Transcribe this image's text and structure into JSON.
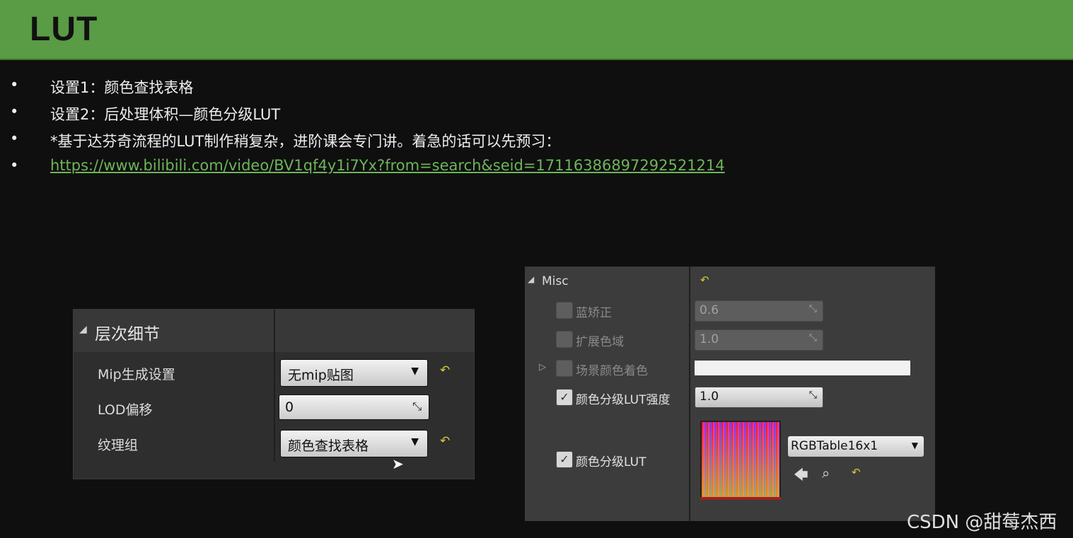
{
  "slide": {
    "title": "LUT",
    "bullets": [
      {
        "text": "设置1：颜色查找表格"
      },
      {
        "text": "设置2：后处理体积—颜色分级LUT"
      },
      {
        "text": "*基于达芬奇流程的LUT制作稍复杂，进阶课会专门讲。着急的话可以先预习："
      },
      {
        "text": "https://www.bilibili.com/video/BV1qf4y1i7Yx?from=search&seid=17116386897292521214",
        "is_link": true
      }
    ],
    "bullet_glyph": "•"
  },
  "lod_panel": {
    "header": "层次细节",
    "rows": [
      {
        "label": "Mip生成设置",
        "value": "无mip贴图",
        "control": "dropdown",
        "has_reset": true
      },
      {
        "label": "LOD偏移",
        "value": "0",
        "control": "number",
        "has_reset": false
      },
      {
        "label": "纹理组",
        "value": "颜色查找表格",
        "control": "dropdown",
        "has_reset": true
      }
    ]
  },
  "misc_panel": {
    "header": "Misc",
    "rows": [
      {
        "label": "蓝矫正",
        "checked": false,
        "value": "0.6"
      },
      {
        "label": "扩展色域",
        "checked": false,
        "value": "1.0"
      },
      {
        "label": "场景颜色着色",
        "checked": false,
        "value": ""
      },
      {
        "label": "颜色分级LUT强度",
        "checked": true,
        "value": "1.0"
      },
      {
        "label": "颜色分级LUT",
        "checked": true,
        "value": "RGBTable16x1"
      }
    ]
  },
  "icons": {
    "reset": "↶",
    "dropdown_arrow": "▼",
    "expand": "▷",
    "collapse": "◢",
    "check": "✓",
    "back": "🡄",
    "search": "⌕",
    "resize": "⤡"
  },
  "colors": {
    "header_bg": "#5a9b45",
    "link": "#6db55a",
    "reset_icon": "#d8c840"
  },
  "watermark": "CSDN @甜莓杰西"
}
